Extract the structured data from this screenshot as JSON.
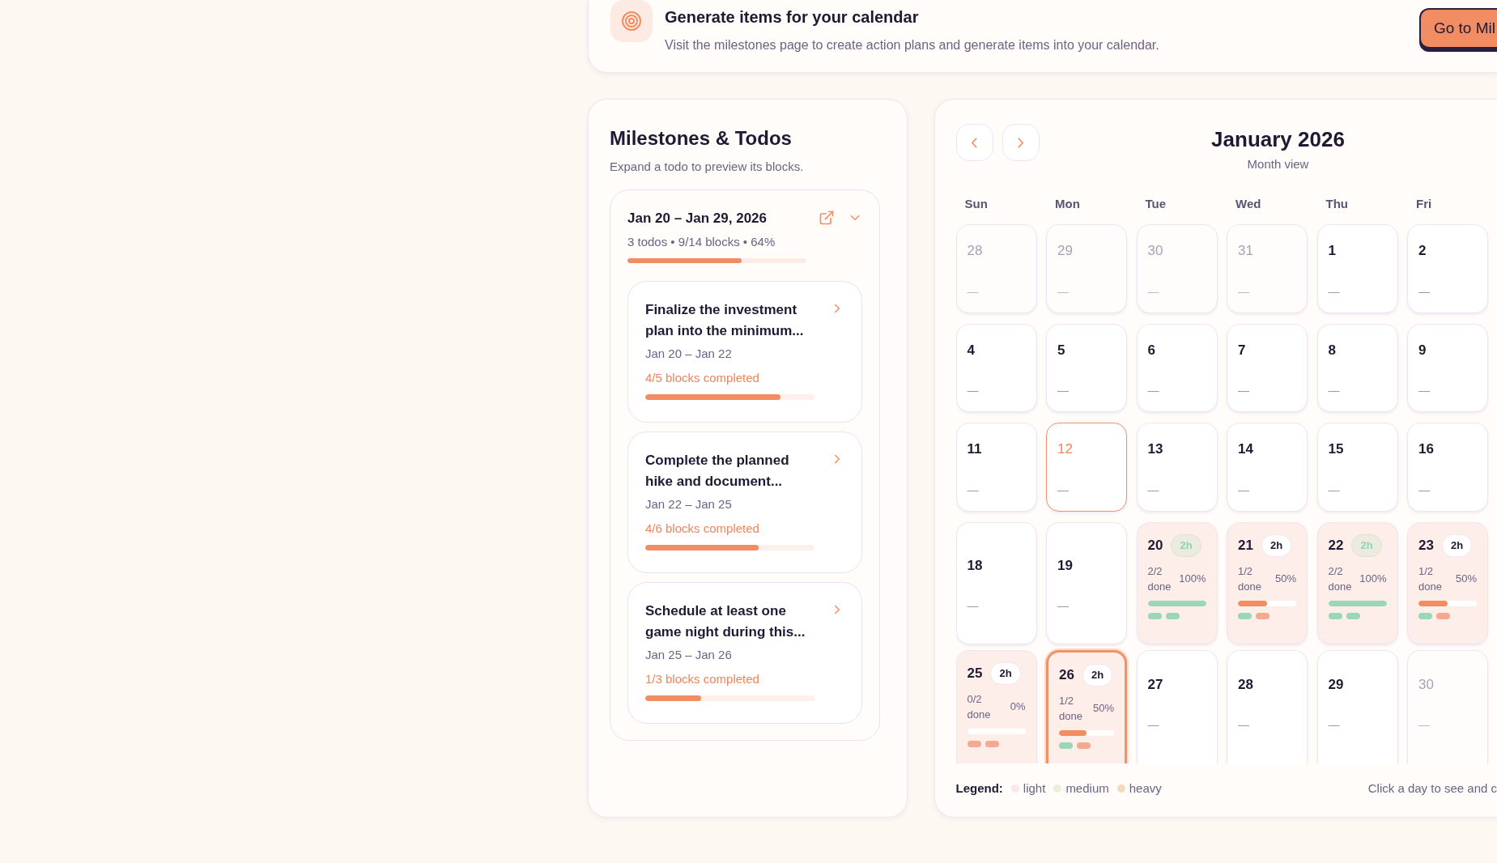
{
  "banner": {
    "title": "Generate items for your calendar",
    "description": "Visit the milestones page to create action plans and generate items into your calendar.",
    "button": "Go to Mil"
  },
  "milestones": {
    "title": "Milestones & Todos",
    "subtitle": "Expand a todo to preview its blocks.",
    "group": {
      "date_range": "Jan 20 – Jan 29, 2026",
      "meta": "3 todos • 9/14 blocks • 64%",
      "level": 0.64,
      "expanded": true,
      "todos": [
        {
          "title": "Finalize the investment plan into the minimum...",
          "dates": "Jan 20 – Jan 22",
          "progress": "4/5 blocks completed",
          "level": 0.8,
          "expanded": false
        },
        {
          "title": "Complete the planned hike and document...",
          "dates": "Jan 22 – Jan 25",
          "progress": "4/6 blocks completed",
          "level": 0.67,
          "expanded": false
        },
        {
          "title": "Schedule at least one game night during this...",
          "dates": "Jan 25 – Jan 26",
          "progress": "1/3 blocks completed",
          "level": 0.33,
          "expanded": false
        }
      ]
    }
  },
  "calendar": {
    "title": "January 2026",
    "subtitle": "Month view",
    "weekdays": [
      "Sun",
      "Mon",
      "Tue",
      "Wed",
      "Thu",
      "Fri"
    ],
    "weeks": [
      [
        {
          "day": "28",
          "kind": "empty",
          "muted": true,
          "today": false,
          "selected": false,
          "summary": "—"
        },
        {
          "day": "29",
          "kind": "empty",
          "muted": true,
          "today": false,
          "selected": false,
          "summary": "—"
        },
        {
          "day": "30",
          "kind": "empty",
          "muted": true,
          "today": false,
          "selected": false,
          "summary": "—"
        },
        {
          "day": "31",
          "kind": "empty",
          "muted": true,
          "today": false,
          "selected": false,
          "summary": "—"
        },
        {
          "day": "1",
          "kind": "empty",
          "muted": false,
          "today": false,
          "selected": false,
          "summary": "—"
        },
        {
          "day": "2",
          "kind": "empty",
          "muted": false,
          "today": false,
          "selected": false,
          "summary": "—"
        }
      ],
      [
        {
          "day": "4",
          "kind": "empty",
          "muted": false,
          "today": false,
          "selected": false,
          "summary": "—"
        },
        {
          "day": "5",
          "kind": "empty",
          "muted": false,
          "today": false,
          "selected": false,
          "summary": "—"
        },
        {
          "day": "6",
          "kind": "empty",
          "muted": false,
          "today": false,
          "selected": false,
          "summary": "—"
        },
        {
          "day": "7",
          "kind": "empty",
          "muted": false,
          "today": false,
          "selected": false,
          "summary": "—"
        },
        {
          "day": "8",
          "kind": "empty",
          "muted": false,
          "today": false,
          "selected": false,
          "summary": "—"
        },
        {
          "day": "9",
          "kind": "empty",
          "muted": false,
          "today": false,
          "selected": false,
          "summary": "—"
        }
      ],
      [
        {
          "day": "11",
          "kind": "empty",
          "muted": false,
          "today": false,
          "selected": false,
          "summary": "—"
        },
        {
          "day": "12",
          "kind": "empty",
          "muted": false,
          "today": true,
          "selected": false,
          "summary": "—"
        },
        {
          "day": "13",
          "kind": "empty",
          "muted": false,
          "today": false,
          "selected": false,
          "summary": "—"
        },
        {
          "day": "14",
          "kind": "empty",
          "muted": false,
          "today": false,
          "selected": false,
          "summary": "—"
        },
        {
          "day": "15",
          "kind": "empty",
          "muted": false,
          "today": false,
          "selected": false,
          "summary": "—"
        },
        {
          "day": "16",
          "kind": "empty",
          "muted": false,
          "today": false,
          "selected": false,
          "summary": "—"
        }
      ],
      [
        {
          "day": "18",
          "kind": "empty",
          "muted": false,
          "today": false,
          "selected": false,
          "summary": "—"
        },
        {
          "day": "19",
          "kind": "empty",
          "muted": false,
          "today": false,
          "selected": false,
          "summary": "—"
        },
        {
          "day": "20",
          "kind": "scheduled",
          "muted": false,
          "today": false,
          "selected": false,
          "badge": "2h",
          "complete": true,
          "done": "2/2 done",
          "percent": "100%",
          "level": 1,
          "blocks": [
            {
              "color": "#98d7b8"
            },
            {
              "color": "#98d7b8"
            }
          ]
        },
        {
          "day": "21",
          "kind": "scheduled",
          "muted": false,
          "today": false,
          "selected": false,
          "badge": "2h",
          "complete": false,
          "done": "1/2 done",
          "percent": "50%",
          "level": 0.5,
          "blocks": [
            {
              "color": "#98d7b8"
            },
            {
              "color": "#f5aa90"
            }
          ]
        },
        {
          "day": "22",
          "kind": "scheduled",
          "muted": false,
          "today": false,
          "selected": false,
          "badge": "2h",
          "complete": true,
          "done": "2/2 done",
          "percent": "100%",
          "level": 1,
          "blocks": [
            {
              "color": "#98d7b8"
            },
            {
              "color": "#98d7b8"
            }
          ]
        },
        {
          "day": "23",
          "kind": "scheduled",
          "muted": false,
          "today": false,
          "selected": false,
          "badge": "2h",
          "complete": false,
          "done": "1/2 done",
          "percent": "50%",
          "level": 0.5,
          "blocks": [
            {
              "color": "#98d7b8"
            },
            {
              "color": "#f5aa90"
            }
          ]
        }
      ],
      [
        {
          "day": "25",
          "kind": "scheduled",
          "muted": false,
          "today": false,
          "selected": false,
          "badge": "2h",
          "complete": false,
          "done": "0/2 done",
          "percent": "0%",
          "level": 0,
          "blocks": [
            {
              "color": "#f5aa90"
            },
            {
              "color": "#f5aa90"
            }
          ]
        },
        {
          "day": "26",
          "kind": "scheduled",
          "muted": false,
          "today": false,
          "selected": true,
          "badge": "2h",
          "complete": false,
          "done": "1/2 done",
          "percent": "50%",
          "level": 0.5,
          "blocks": [
            {
              "color": "#98d7b8"
            },
            {
              "color": "#f5aa90"
            }
          ]
        },
        {
          "day": "27",
          "kind": "empty",
          "muted": false,
          "today": false,
          "selected": false,
          "summary": "—"
        },
        {
          "day": "28",
          "kind": "empty",
          "muted": false,
          "today": false,
          "selected": false,
          "summary": "—"
        },
        {
          "day": "29",
          "kind": "empty",
          "muted": false,
          "today": false,
          "selected": false,
          "summary": "—"
        },
        {
          "day": "30",
          "kind": "empty",
          "muted": true,
          "today": false,
          "selected": false,
          "summary": "—"
        }
      ]
    ]
  },
  "legend": {
    "label": "Legend:",
    "items": [
      {
        "label": "light",
        "color": "#fbe6ee"
      },
      {
        "label": "medium",
        "color": "#efecd9"
      },
      {
        "label": "heavy",
        "color": "#f3d9bd"
      }
    ]
  },
  "hint": "Click a day to see and c"
}
